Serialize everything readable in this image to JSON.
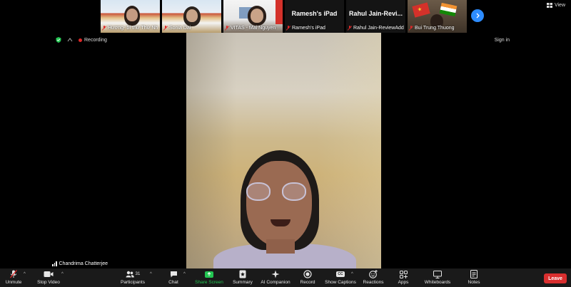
{
  "thumbnails": [
    {
      "name": "Hương- bí thư Thứ Nh..."
    },
    {
      "name": "Sonia Dai"
    },
    {
      "name": "VITAS - Mai Nguyen"
    },
    {
      "name": "Ramesh's iPad",
      "display_name": "Ramesh's iPad"
    },
    {
      "name": "Rahul Jain-ReviewAdda",
      "display_name": "Rahul Jain-Revi..."
    },
    {
      "name": "Bui Trung Thuong"
    }
  ],
  "view_label": "View",
  "status": {
    "recording_label": "Recording",
    "signin_label": "Sign in"
  },
  "active_speaker": "Chandrima Chatterjee",
  "toolbar": {
    "unmute": "Unmute",
    "stop_video": "Stop Video",
    "participants": "Participants",
    "participant_count": "31",
    "chat": "Chat",
    "share_screen": "Share Screen",
    "summary": "Summary",
    "ai_companion": "AI Companion",
    "record": "Record",
    "cc_badge": "CC",
    "show_captions": "Show Captions",
    "reactions": "Reactions",
    "apps": "Apps",
    "whiteboards": "Whiteboards",
    "notes": "Notes",
    "leave": "Leave"
  },
  "colors": {
    "leave": "#d92f2f",
    "share": "#23c552",
    "accent": "#2d8cff",
    "recording": "#e02828"
  }
}
